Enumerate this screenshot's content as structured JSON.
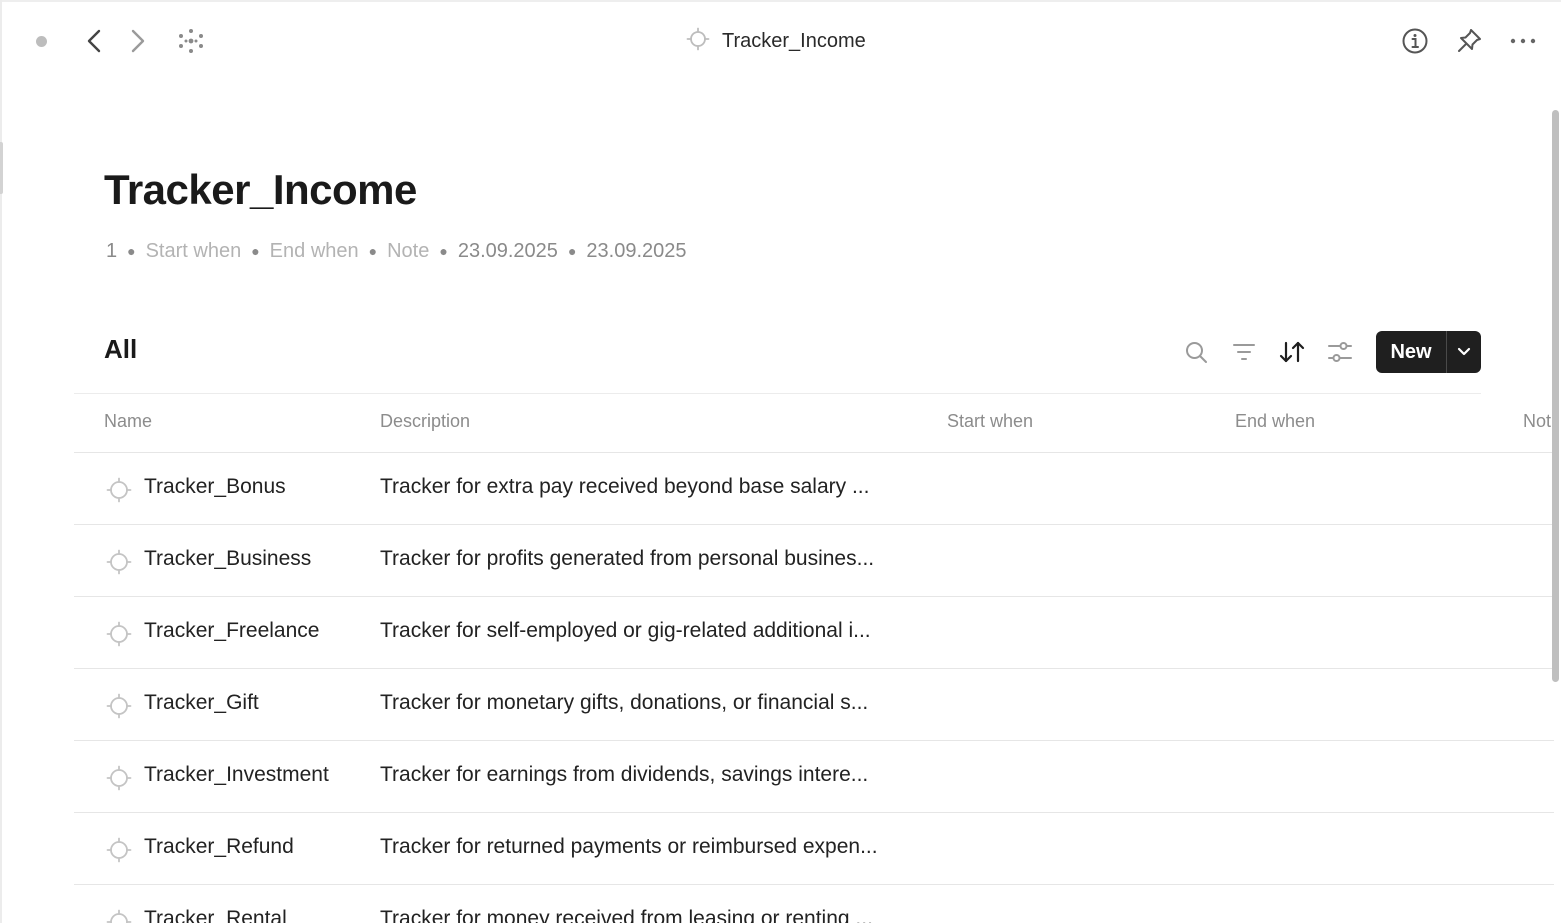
{
  "window": {
    "title": "Tracker_Income"
  },
  "topbar": {
    "icons": [
      "status-dot-icon",
      "back-arrow-icon",
      "forward-arrow-icon",
      "graph-icon",
      "info-icon",
      "pin-icon",
      "more-icon"
    ]
  },
  "page": {
    "title": "Tracker_Income",
    "meta": {
      "count": "1",
      "start_when": "Start when",
      "end_when": "End when",
      "note": "Note",
      "created": "23.09.2025",
      "modified": "23.09.2025"
    }
  },
  "view": {
    "label": "All",
    "new_label": "New"
  },
  "table": {
    "columns": [
      "Name",
      "Description",
      "Start when",
      "End when",
      "Not"
    ],
    "rows": [
      {
        "name": "Tracker_Bonus",
        "description": "Tracker for extra pay received beyond base salary ..."
      },
      {
        "name": "Tracker_Business",
        "description": "Tracker for profits generated from personal busines..."
      },
      {
        "name": "Tracker_Freelance",
        "description": "Tracker for self-employed or gig-related additional i..."
      },
      {
        "name": "Tracker_Gift",
        "description": "Tracker for monetary gifts, donations, or financial s..."
      },
      {
        "name": "Tracker_Investment",
        "description": "Tracker for earnings from dividends, savings intere..."
      },
      {
        "name": "Tracker_Refund",
        "description": "Tracker for returned payments or reimbursed expen..."
      },
      {
        "name": "Tracker_Rental",
        "description": "Tracker for money received from leasing or renting ..."
      }
    ]
  },
  "colors": {
    "accent_dark": "#1f1f1f",
    "muted_text": "#8c8c8c",
    "faint_text": "#b3b3b3"
  }
}
